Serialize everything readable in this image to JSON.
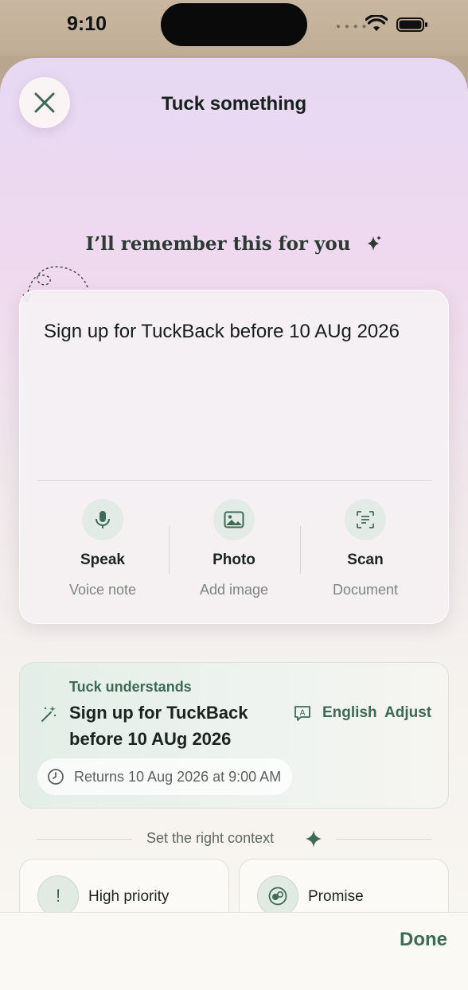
{
  "status_bar": {
    "time": "9:10"
  },
  "sheet": {
    "title": "Tuck something",
    "tagline": "I’ll remember this for you"
  },
  "input": {
    "text": "Sign up for TuckBack before 10 AUg 2026"
  },
  "actions": [
    {
      "title": "Speak",
      "subtitle": "Voice note",
      "icon": "microphone-icon"
    },
    {
      "title": "Photo",
      "subtitle": "Add image",
      "icon": "image-icon"
    },
    {
      "title": "Scan",
      "subtitle": "Document",
      "icon": "scan-icon"
    }
  ],
  "understands": {
    "label": "Tuck understands",
    "text": "Sign up for TuckBack before 10 AUg 2026",
    "language": "English",
    "adjust": "Adjust",
    "returns": "Returns 10 Aug 2026 at 9:00 AM"
  },
  "context": {
    "label": "Set the right context",
    "chips": [
      {
        "label": "High priority",
        "icon": "exclamation-icon"
      },
      {
        "label": "Promise",
        "icon": "promise-icon"
      }
    ]
  },
  "footer": {
    "done": "Done"
  },
  "colors": {
    "accent": "#3e6b56",
    "sheet_top": "#e7d9f3",
    "sheet_bottom": "#f8f6f1"
  }
}
